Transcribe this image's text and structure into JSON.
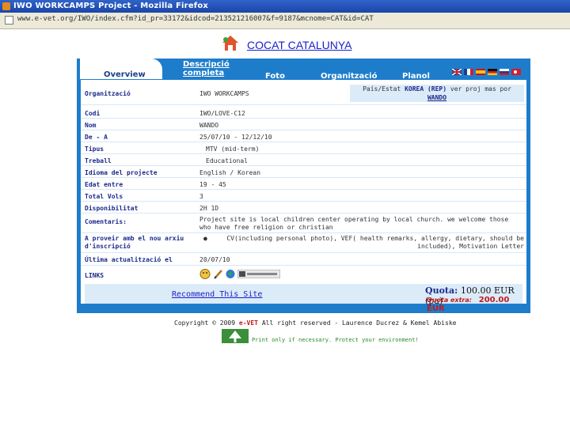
{
  "window": {
    "title": "IWO WORKCAMPS Project - Mozilla Firefox"
  },
  "address": {
    "url": "www.e-vet.org/IWO/index.cfm?id_pr=33172&idcod=213521216007&f=9187&mcnome=CAT&id=CAT"
  },
  "site": {
    "header_title": "COCAT CATALUNYA"
  },
  "tabs": [
    {
      "label": "Overview"
    },
    {
      "label": "Descripció completa"
    },
    {
      "label": "Foto"
    },
    {
      "label": "Organització"
    },
    {
      "label": "Planol"
    }
  ],
  "flags": [
    "uk",
    "fr",
    "es",
    "de",
    "ru",
    "tr"
  ],
  "organizacio": {
    "label": "Organització",
    "value": "IWO WORKCAMPS"
  },
  "pais": {
    "prefix": "País/Estat",
    "country": "KOREA (REP)",
    "mid": "ver proj mas por",
    "name": "WANDO"
  },
  "fields": [
    {
      "label": "Codi",
      "value": "IWO/LOVE-C12"
    },
    {
      "label": "Nom",
      "value": "WANDO"
    },
    {
      "label": "De - A",
      "value": "25/07/10 - 12/12/10"
    },
    {
      "label": "Tipus",
      "value": "MTV (mid-term)"
    },
    {
      "label": "Treball",
      "value": "Educational"
    },
    {
      "label": "Idioma del projecte",
      "value": "English / Korean"
    },
    {
      "label": "Edat entre",
      "value": "19 - 45"
    },
    {
      "label": "Total Vols",
      "value": "3"
    },
    {
      "label": "Disponibilitat",
      "value": "2H 1D"
    }
  ],
  "comentaris": {
    "label": "Comentaris:",
    "value": "Project site is local children center operating by local church. we welcome those who have free religion or christian"
  },
  "aproveir": {
    "label": "A proveir amb el nou arxiu d'inscripció",
    "value": "CV(including personal photo), VEF( health remarks, allergy, dietary, should be included), Motivation Letter"
  },
  "actualitzacio": {
    "label": "Última actualització el",
    "value": "20/07/10"
  },
  "links": {
    "label": "LINKS"
  },
  "recommend": {
    "label": "Recommend This Site"
  },
  "quota": {
    "label": "Quota:",
    "value": "100.00 EUR (pa)",
    "extra_label": "Quota extra:",
    "extra_value": "200.00 EUR"
  },
  "footer": {
    "copyright": "Copyright © 2009",
    "brand": "e-VET",
    "rights": "All right reserved - Laurence Ducrez & Kemel Abiske",
    "eco": "Print only if necessary. Protect your environment!"
  },
  "colors": {
    "frame": "#1e7dcb",
    "label": "#1b2a8a",
    "link": "#1a22c8",
    "price_extra": "#c21a1a"
  }
}
